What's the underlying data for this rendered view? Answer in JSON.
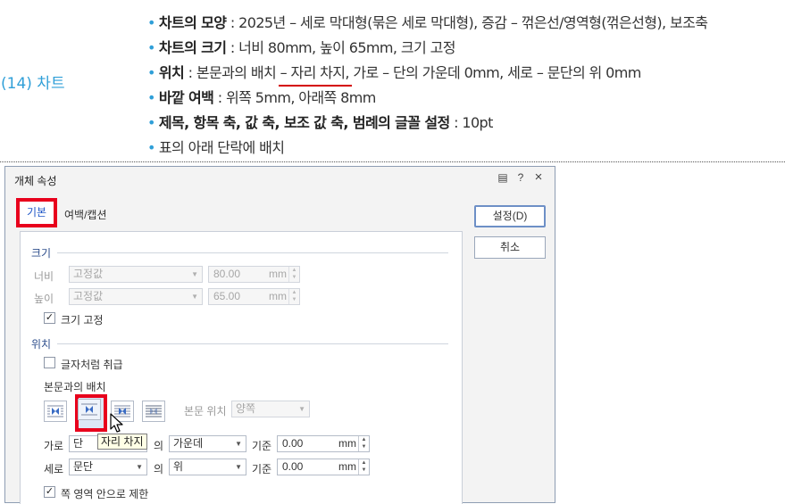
{
  "instructions": {
    "section_label": "(14) 차트",
    "bullet_dot": "•",
    "lines": [
      {
        "bold": "차트의 모양",
        "text": " : 2025년 – 세로 막대형(묶은 세로 막대형), 증감 – 꺾은선/영역형(꺾은선형), 보조축"
      },
      {
        "bold": "차트의 크기",
        "text": " : 너비 80mm, 높이 65mm, 크기 고정"
      },
      {
        "bold": "위치",
        "text_before": " : 본문과의 배치 ",
        "underlined": "– 자리 차지,",
        "text_after": " 가로 – 단의 가운데 0mm, 세로 – 문단의 위 0mm"
      },
      {
        "bold": "바깥 여백",
        "text": " : 위쪽 5mm, 아래쪽 8mm"
      },
      {
        "bold": "제목, 항목 축, 값 축, 보조 값 축, 범례의 글꼴 설정",
        "text": " : 10pt"
      },
      {
        "bold": "",
        "text": "표의 아래 단락에 배치"
      }
    ]
  },
  "dialog": {
    "title": "개체 속성",
    "title_buttons": {
      "help_menu": "▤",
      "help": "?",
      "close": "×"
    },
    "tabs": {
      "basic": "기본",
      "margin_caption": "여백/캡션"
    },
    "buttons": {
      "ok": "설정(D)",
      "cancel": "취소"
    },
    "size": {
      "group": "크기",
      "width_label": "너비",
      "width_mode": "고정값",
      "width_value": "80.00",
      "height_label": "높이",
      "height_mode": "고정값",
      "height_value": "65.00",
      "unit": "mm",
      "fix_size_label": "크기 고정",
      "fix_size_checked": true
    },
    "position": {
      "group": "위치",
      "treat_as_char_label": "글자처럼 취급",
      "treat_as_char_checked": false,
      "wrap_label": "본문과의 배치",
      "wrap_options": [
        "어울림",
        "자리 차지",
        "글 앞으로",
        "글 뒤로"
      ],
      "wrap_selected": 1,
      "text_side_label": "본문 위치",
      "text_side_value": "양쪽",
      "tooltip": "자리 차지",
      "horizontal_label": "가로",
      "horizontal_ref": "단",
      "of_label": "의",
      "horizontal_align": "가운데",
      "base_label": "기준",
      "horizontal_offset": "0.00",
      "vertical_label": "세로",
      "vertical_ref": "문단",
      "vertical_align": "위",
      "vertical_offset": "0.00",
      "unit": "mm",
      "limit_label": "쪽 영역 안으로 제한",
      "limit_checked": true
    }
  }
}
